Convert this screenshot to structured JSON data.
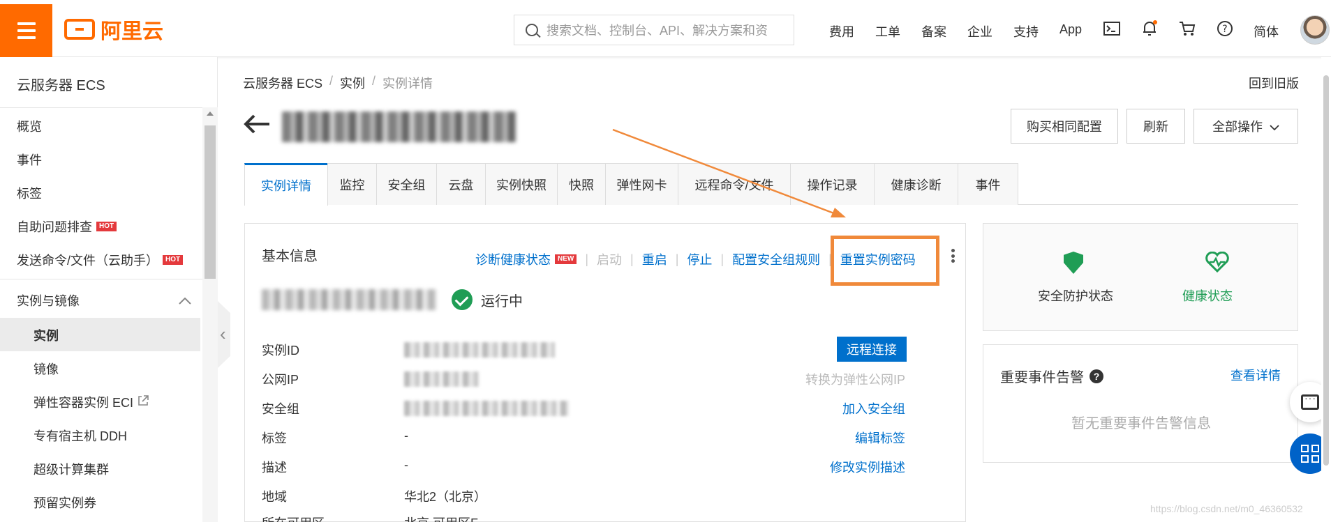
{
  "brand": {
    "logo_text": "阿里云",
    "accent": "#ff6a00",
    "link_color": "#0070cc",
    "ok_color": "#1f9d55"
  },
  "topbar": {
    "search_placeholder": "搜索文档、控制台、API、解决方案和资",
    "links": [
      "费用",
      "工单",
      "备案",
      "企业",
      "支持",
      "App"
    ],
    "icons": [
      "terminal-icon",
      "bell-icon",
      "cart-icon",
      "help-icon"
    ],
    "lang": "简体"
  },
  "sidebar": {
    "title": "云服务器 ECS",
    "items": [
      {
        "label": "概览"
      },
      {
        "label": "事件"
      },
      {
        "label": "标签"
      },
      {
        "label": "自助问题排查",
        "badge": "HOT"
      },
      {
        "label": "发送命令/文件（云助手）",
        "badge": "HOT"
      }
    ],
    "group": "实例与镜像",
    "sub_items": [
      "实例",
      "镜像",
      "弹性容器实例 ECI",
      "专有宿主机 DDH",
      "超级计算集群",
      "预留实例券"
    ],
    "selected": "实例"
  },
  "breadcrumb": [
    "云服务器 ECS",
    "实例",
    "实例详情"
  ],
  "old_version": "回到旧版",
  "header_buttons": {
    "buy_same": "购买相同配置",
    "refresh": "刷新",
    "all_ops": "全部操作"
  },
  "tabs": [
    "实例详情",
    "监控",
    "安全组",
    "云盘",
    "实例快照",
    "快照",
    "弹性网卡",
    "远程命令/文件",
    "操作记录",
    "健康诊断",
    "事件"
  ],
  "basic": {
    "title": "基本信息",
    "actions": {
      "diagnose": "诊断健康状态",
      "new_badge": "NEW",
      "start": "启动",
      "restart": "重启",
      "stop": "停止",
      "config_sg": "配置安全组规则",
      "reset_pwd": "重置实例密码"
    },
    "status": "运行中",
    "rows": [
      {
        "label": "实例ID",
        "value": ""
      },
      {
        "label": "公网IP",
        "value": ""
      },
      {
        "label": "安全组",
        "value": ""
      },
      {
        "label": "标签",
        "value": "-"
      },
      {
        "label": "描述",
        "value": "-"
      },
      {
        "label": "地域",
        "value": "华北2（北京）"
      },
      {
        "label": "所在可用区",
        "value": "北京 可用区F"
      }
    ],
    "row_links": {
      "remote": "远程连接",
      "to_eip": "转换为弹性公网IP",
      "join_sg": "加入安全组",
      "edit_tag": "编辑标签",
      "edit_desc": "修改实例描述"
    }
  },
  "protect": {
    "security": "安全防护状态",
    "health": "健康状态"
  },
  "events": {
    "title": "重要事件告警",
    "link": "查看详情",
    "empty": "暂无重要事件告警信息"
  },
  "watermark": "https://blog.csdn.net/m0_46360532"
}
